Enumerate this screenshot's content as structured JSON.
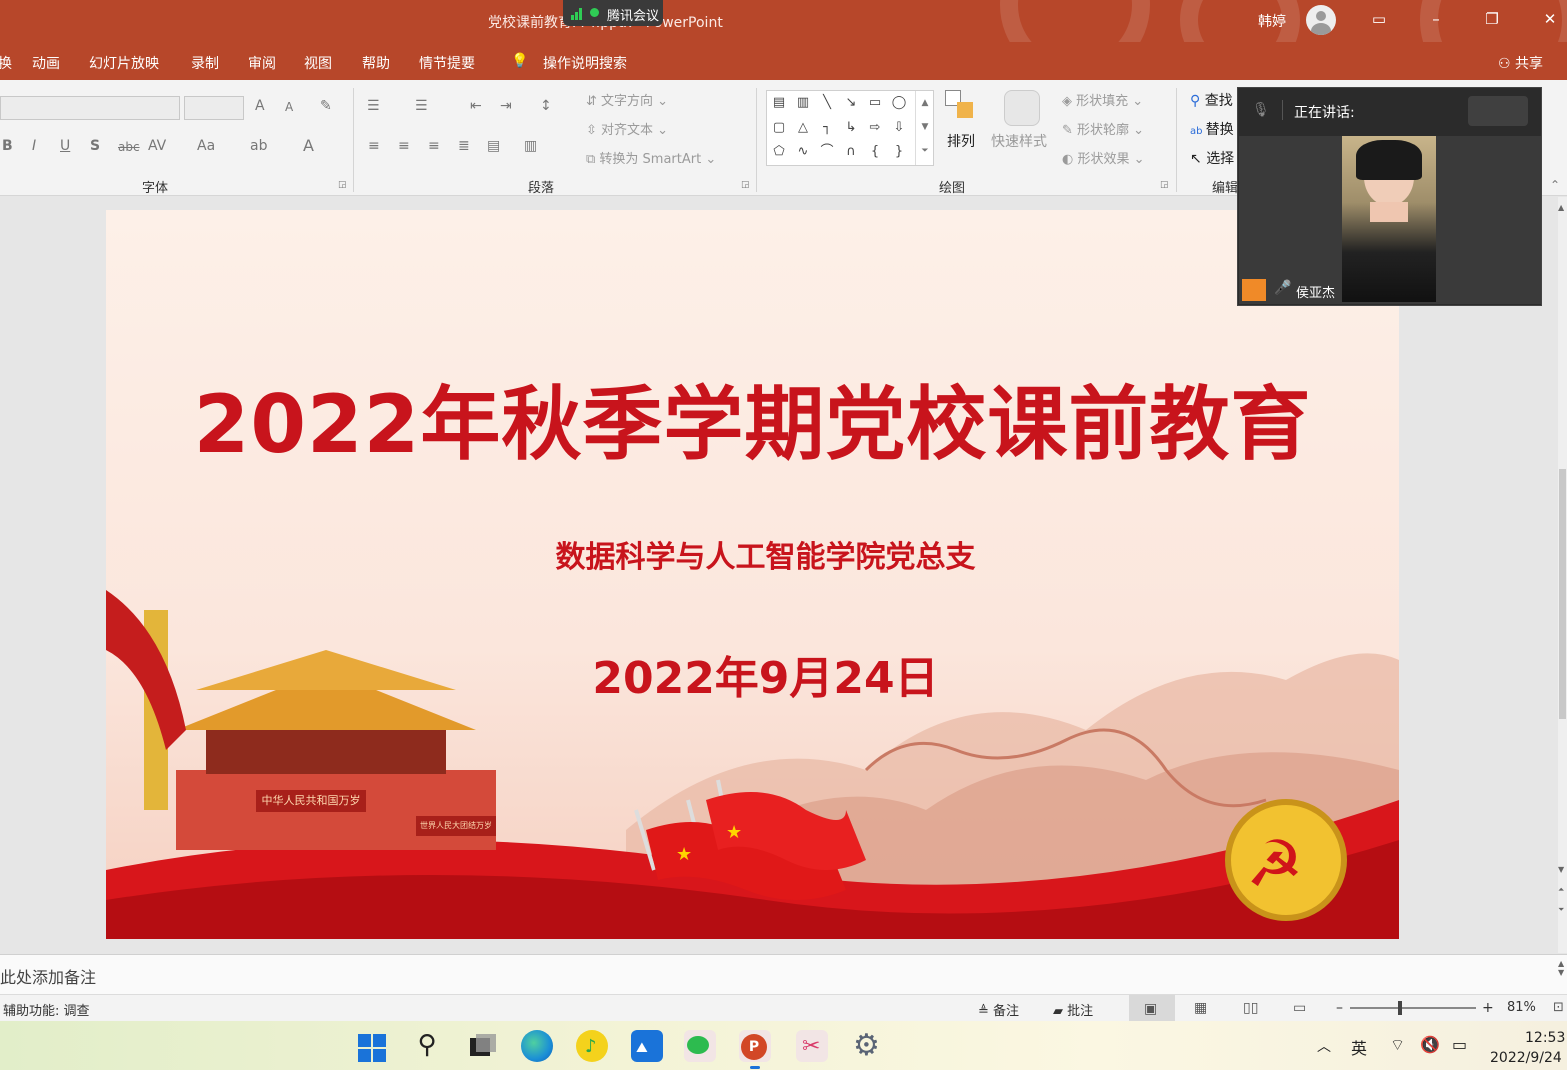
{
  "window": {
    "doc_title": "党校课前教育PPT.pptx - PowerPoint",
    "meeting_app": "腾讯会议",
    "user_name": "韩婷",
    "share_label": "共享"
  },
  "tabs": [
    "换",
    "动画",
    "幻灯片放映",
    "录制",
    "审阅",
    "视图",
    "帮助",
    "情节提要"
  ],
  "tell_me": "操作说明搜索",
  "ribbon": {
    "groups": {
      "font": "字体",
      "paragraph": "段落",
      "drawing": "绘图",
      "editing": "编辑"
    },
    "paragraph_cmds": {
      "text_direction": "文字方向",
      "align_text": "对齐文本",
      "smartart": "转换为 SmartArt"
    },
    "drawing_cmds": {
      "arrange": "排列",
      "quick_styles": "快速样式",
      "shape_fill": "形状填充",
      "shape_outline": "形状轮廓",
      "shape_effects": "形状效果"
    },
    "editing_cmds": {
      "find": "查找",
      "replace": "替换",
      "select": "选择"
    },
    "font_buttons": {
      "bold": "B",
      "italic": "I",
      "underline": "U",
      "shadow": "S",
      "strike": "abc",
      "spacing": "AV",
      "case": "Aa",
      "grow": "A",
      "shrink": "A",
      "color": "A"
    }
  },
  "video": {
    "speaking_label": "正在讲话:",
    "participant": "侯亚杰"
  },
  "slide": {
    "title": "2022年秋季学期党校课前教育",
    "subtitle": "数据科学与人工智能学院党总支",
    "date": "2022年9月24日",
    "banner_left": "中华人民共和国万岁",
    "banner_right": "世界人民大团结万岁"
  },
  "notes": {
    "placeholder": "此处添加备注"
  },
  "status": {
    "accessibility": "辅助功能: 调查",
    "notes_btn": "备注",
    "comments_btn": "批注",
    "zoom": "81%",
    "zoom_level": 0.4
  },
  "taskbar": {
    "apps": [
      "start-icon",
      "search-icon",
      "task-view-icon",
      "edge-icon",
      "music-icon",
      "photos-icon",
      "wechat-icon",
      "powerpoint-icon",
      "snipping-tool-icon",
      "settings-icon"
    ],
    "ime": "英",
    "time": "12:53",
    "date": "2022/9/24"
  }
}
